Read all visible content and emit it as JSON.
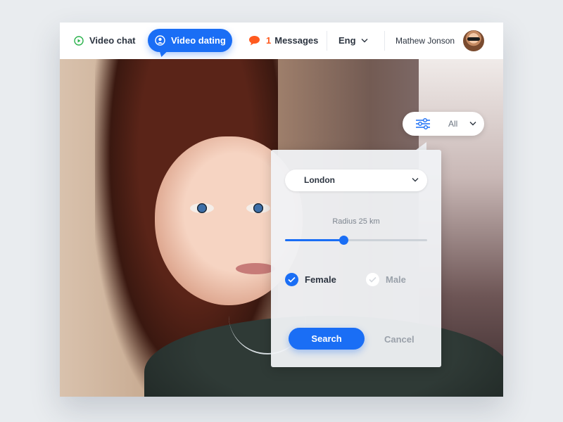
{
  "nav": {
    "video_chat": "Video chat",
    "video_dating": "Video dating",
    "messages_count": "1",
    "messages": "Messages",
    "language": "Eng",
    "user_name": "Mathew Jonson"
  },
  "filter": {
    "selected": "All"
  },
  "panel": {
    "city": "London",
    "radius_label": "Radius 25 km",
    "radius_fraction": 0.41,
    "female_label": "Female",
    "female_checked": true,
    "male_label": "Male",
    "male_checked": false,
    "search_label": "Search",
    "cancel_label": "Cancel"
  },
  "colors": {
    "accent": "#1a6ef5",
    "message_icon": "#ff5a1f",
    "video_chat_icon": "#2bb24c"
  },
  "icons": [
    "play-icon",
    "user-icon",
    "chat-bubble-icon",
    "chevron-down-icon",
    "sliders-icon",
    "check-icon"
  ]
}
